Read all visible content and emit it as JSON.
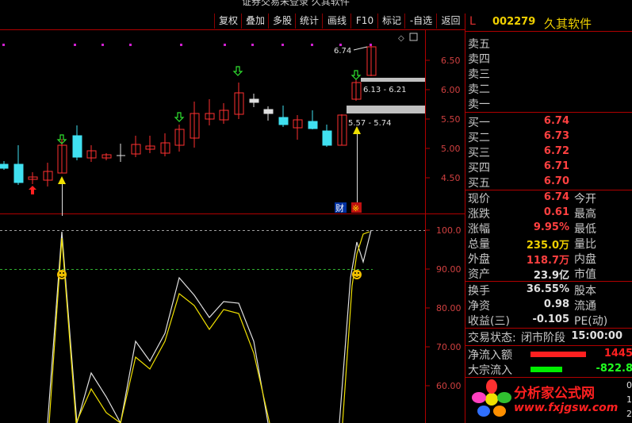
{
  "window_title": "证券交易未登录  久其软件",
  "toolbar": [
    "复权",
    "叠加",
    "多股",
    "统计",
    "画线",
    "F10",
    "标记",
    "-自选",
    "返回"
  ],
  "price_axis": [
    "6.50",
    "6.00",
    "5.50",
    "5.00",
    "4.50"
  ],
  "indicator_axis": [
    "100.0",
    "90.00",
    "80.00",
    "70.00",
    "60.00"
  ],
  "annotations": {
    "high": "6.74",
    "gap_upper": "6.13 - 6.21",
    "gap_lower": "5.57 - 5.74",
    "cai": "财",
    "event": "※"
  },
  "stock": {
    "flag": "L",
    "code": "002279",
    "name": "久其软件"
  },
  "sell_levels": [
    "卖五",
    "卖四",
    "卖三",
    "卖二",
    "卖一"
  ],
  "buy_levels": [
    {
      "label": "买一",
      "price": "6.74"
    },
    {
      "label": "买二",
      "price": "6.73"
    },
    {
      "label": "买三",
      "price": "6.72"
    },
    {
      "label": "买四",
      "price": "6.71"
    },
    {
      "label": "买五",
      "price": "6.70"
    }
  ],
  "quote": [
    {
      "label": "现价",
      "value": "6.74",
      "label2": "今开",
      "color": "#ff4040"
    },
    {
      "label": "涨跌",
      "value": "0.61",
      "label2": "最高",
      "color": "#ff4040"
    },
    {
      "label": "涨幅",
      "value": "9.95%",
      "label2": "最低",
      "color": "#ff4040"
    },
    {
      "label": "总量",
      "value": "235.0万",
      "label2": "量比",
      "color": "#f0d000"
    },
    {
      "label": "外盘",
      "value": "118.7万",
      "label2": "内盘",
      "color": "#ff4040"
    },
    {
      "label": "资产",
      "value": "23.9亿",
      "label2": "市值",
      "color": "#e0e0e0"
    }
  ],
  "finance": [
    {
      "label": "换手",
      "value": "36.55%",
      "label2": "股本"
    },
    {
      "label": "净资",
      "value": "0.98",
      "label2": "流通"
    },
    {
      "label": "收益(三)",
      "value": "-0.105",
      "label2": "PE(动)"
    }
  ],
  "trade_state": {
    "label": "交易状态:",
    "phase": "闭市阶段",
    "time": "15:00:00"
  },
  "flows": [
    {
      "label": "净流入额",
      "value": "1445",
      "color": "#ff2020",
      "bar": "#ff2020"
    },
    {
      "label": "大宗流入",
      "value": "-822.8",
      "color": "#20ff20",
      "bar": "#00ee00"
    }
  ],
  "logo": {
    "text": "分析家公式网",
    "url": "www.fxjgsw.com"
  },
  "edge_digits": [
    "0",
    "1",
    "2"
  ],
  "colors": {
    "up": "#ff3030",
    "down": "#40e0f0",
    "border": "#b00000"
  }
}
